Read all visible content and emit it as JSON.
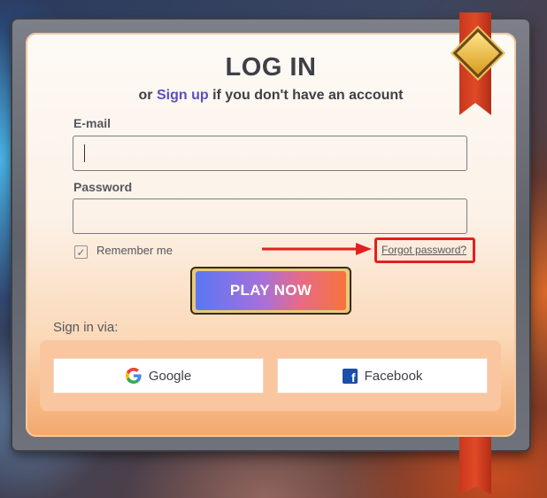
{
  "login": {
    "title": "LOG IN",
    "subtitle_prefix": "or ",
    "signup_link": "Sign up",
    "subtitle_suffix": " if you don't have an account",
    "email_label": "E-mail",
    "email_value": "",
    "password_label": "Password",
    "password_value": "",
    "remember_label": "Remember me",
    "remember_checked": true,
    "forgot_link": "Forgot password?",
    "play_button": "PLAY NOW"
  },
  "social": {
    "label": "Sign in via:",
    "google_label": "Google",
    "facebook_label": "Facebook"
  },
  "colors": {
    "accent_link": "#5b4ec2",
    "highlight_red": "#e3201f",
    "facebook_blue": "#1a4fa8"
  },
  "icons": [
    "check-icon",
    "arrow-annotation",
    "google-icon",
    "facebook-icon",
    "diamond-gem-icon"
  ]
}
